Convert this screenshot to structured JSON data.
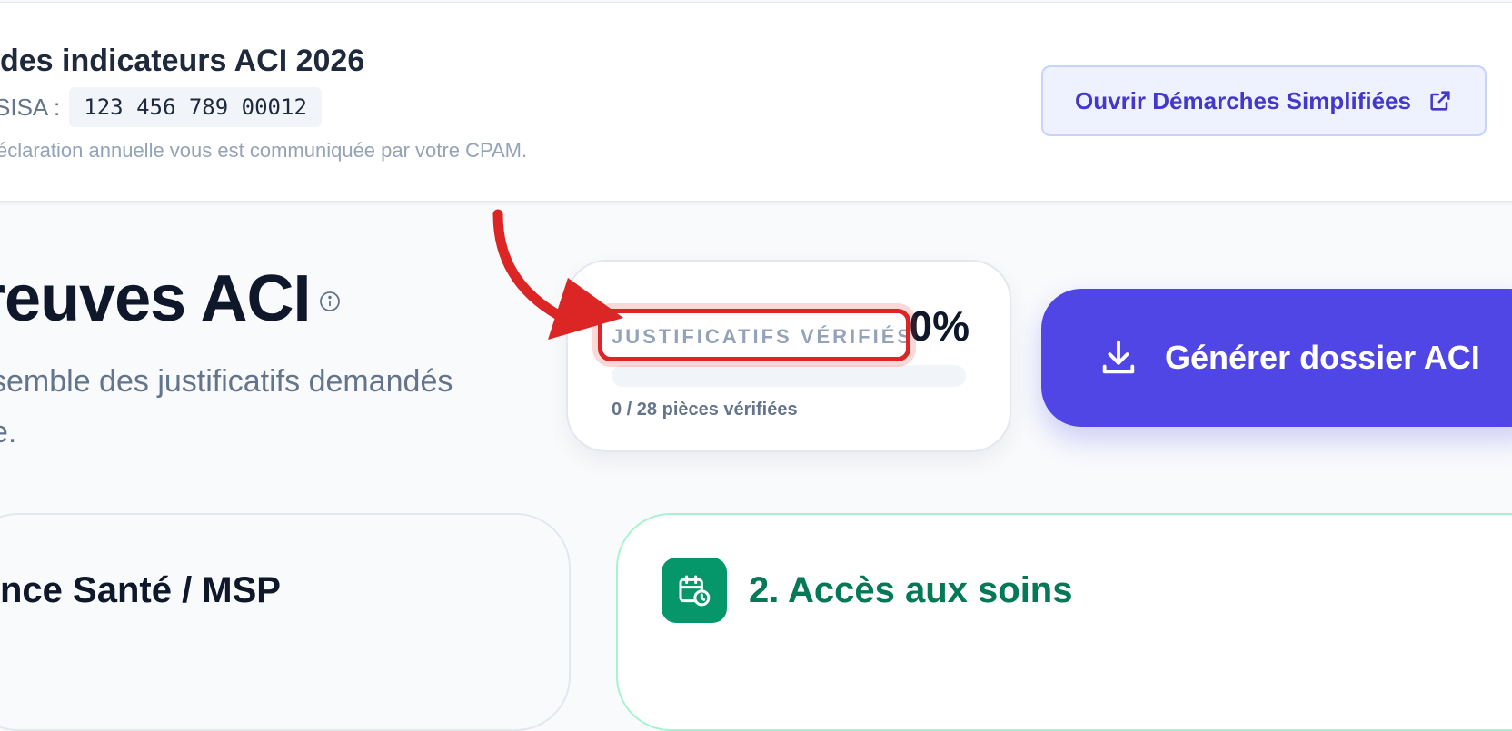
{
  "header": {
    "title": "des indicateurs ACI 2026",
    "finess_label": "SISA :",
    "finess_code": "123 456 789 00012",
    "note": "éclaration annuelle vous est communiquée par votre CPAM.",
    "ds_button_label": "Ouvrir Démarches Simplifiées",
    "ds_button_icon": "external-link-icon"
  },
  "main": {
    "title": "reuves ACI",
    "subtitle_line1": "semble des justificatifs demandés",
    "subtitle_line2": "e.",
    "info_icon": "info-icon"
  },
  "progress": {
    "label": "JUSTIFICATIFS VÉRIFIÉS",
    "percent": "0%",
    "value": 0,
    "count_text": "0 / 28 pièces vérifiées"
  },
  "generate_button": {
    "label": "Générer dossier ACI",
    "icon": "download-icon"
  },
  "sections": [
    {
      "title": "nce Santé / MSP"
    },
    {
      "title": "2. Accès aux soins",
      "icon": "calendar-clock-icon"
    }
  ],
  "colors": {
    "accent": "#4f46e5",
    "success": "#059669",
    "annotation": "#dc2626"
  }
}
